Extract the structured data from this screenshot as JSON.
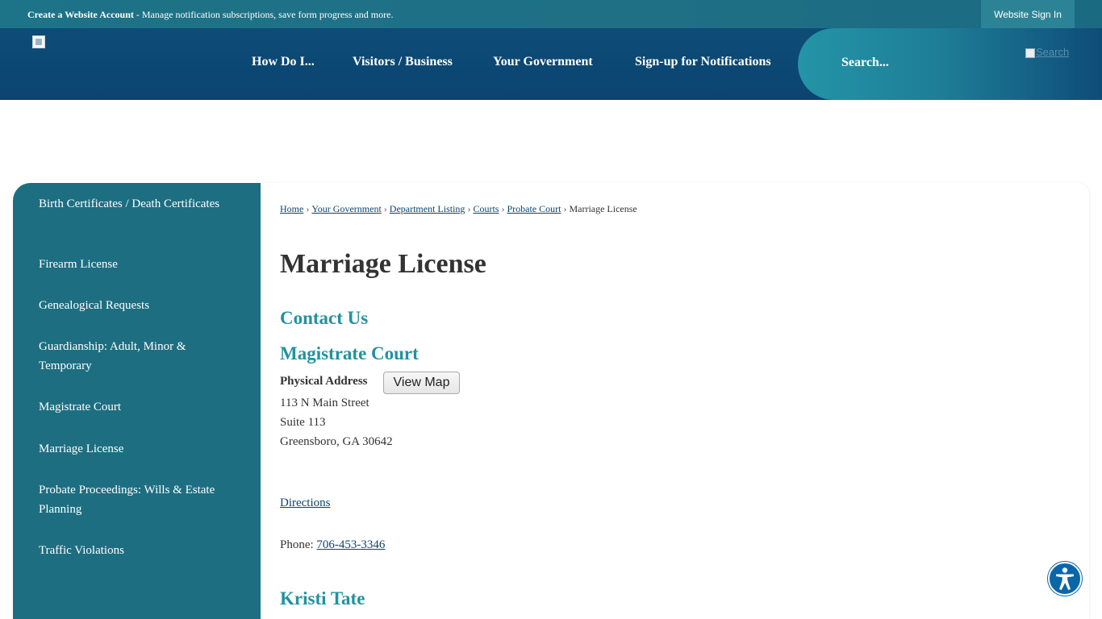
{
  "topbar": {
    "account_link": "Create a Website Account",
    "account_desc": " - Manage notification subscriptions, save form progress and more.",
    "signin": "Website Sign In"
  },
  "nav": [
    "How Do I...",
    "Visitors / Business",
    "Your Government",
    "Sign-up for Notifications"
  ],
  "search": {
    "placeholder": "Search...",
    "button_alt": "Search"
  },
  "sidebar": {
    "items": [
      "Birth Certificates / Death Certificates",
      "Firearm License",
      "Genealogical Requests",
      "Guardianship: Adult, Minor & Temporary",
      "Magistrate Court",
      "Marriage License",
      "Probate Proceedings: Wills & Estate Planning",
      "Traffic Violations"
    ]
  },
  "breadcrumb": {
    "links": [
      "Home",
      "Your Government",
      "Department Listing",
      "Courts",
      "Probate Court"
    ],
    "current": "Marriage License",
    "separator": "›"
  },
  "page_title": "Marriage License",
  "contact": {
    "heading": "Contact Us",
    "org": "Magistrate Court",
    "address_label": "Physical Address",
    "view_map": "View Map",
    "address_lines": [
      "113 N Main Street",
      "Suite 113",
      "Greensboro, GA 30642"
    ],
    "directions": "Directions",
    "phone_label": "Phone: ",
    "phone": "706-453-3346",
    "person": "Kristi Tate"
  }
}
